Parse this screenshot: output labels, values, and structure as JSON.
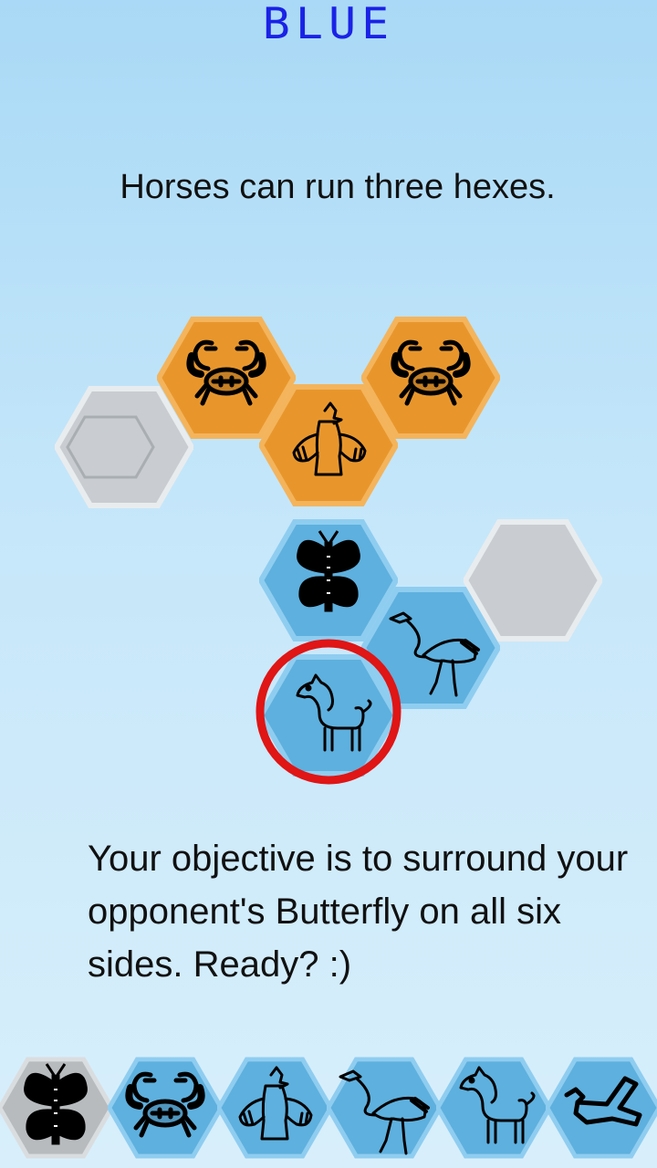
{
  "header": {
    "player": "BLUE"
  },
  "tutorial": {
    "hint": "Horses can run three hexes.",
    "objective": "Your objective is to surround your opponent's Butterfly on all six sides. Ready? :)"
  },
  "colors": {
    "blue_player": "#1a22e6",
    "orange_tile": "#e8962c",
    "blue_tile": "#5eb0de",
    "gray_tile": "#c9cdd1",
    "highlight_ring": "#e01515"
  },
  "board": {
    "tiles": [
      {
        "piece": "empty",
        "color": "gray"
      },
      {
        "piece": "crab",
        "color": "orange"
      },
      {
        "piece": "bird",
        "color": "orange"
      },
      {
        "piece": "crab",
        "color": "orange"
      },
      {
        "piece": "butterfly",
        "color": "blue"
      },
      {
        "piece": "empty",
        "color": "gray"
      },
      {
        "piece": "heron",
        "color": "blue"
      },
      {
        "piece": "horse",
        "color": "blue",
        "selected": true
      }
    ]
  },
  "tray": {
    "pieces": [
      {
        "piece": "butterfly",
        "state": "placed"
      },
      {
        "piece": "crab",
        "state": "available"
      },
      {
        "piece": "bird",
        "state": "available"
      },
      {
        "piece": "heron",
        "state": "available"
      },
      {
        "piece": "horse",
        "state": "available"
      },
      {
        "piece": "dove",
        "state": "available"
      }
    ]
  }
}
